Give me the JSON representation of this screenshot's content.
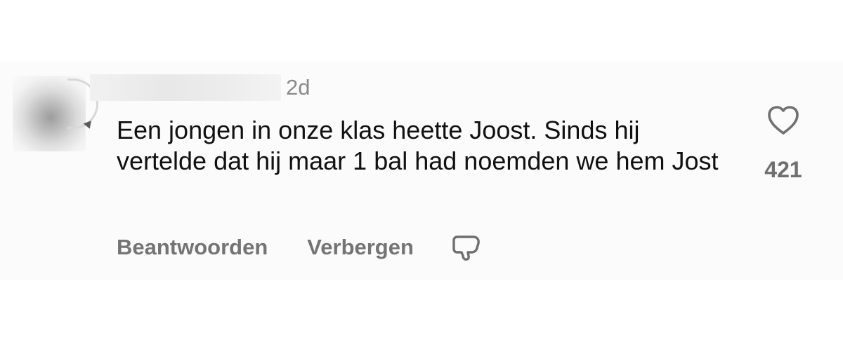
{
  "comment": {
    "timestamp": "2d",
    "text": "Een jongen in onze klas heette Joost. Sinds hij vertelde dat hij maar 1 bal had noemden we hem Jost",
    "like_count": "421",
    "actions": {
      "reply_label": "Beantwoorden",
      "hide_label": "Verbergen"
    },
    "icons": {
      "like": "heart-icon",
      "dislike": "thumbs-down-icon"
    }
  }
}
